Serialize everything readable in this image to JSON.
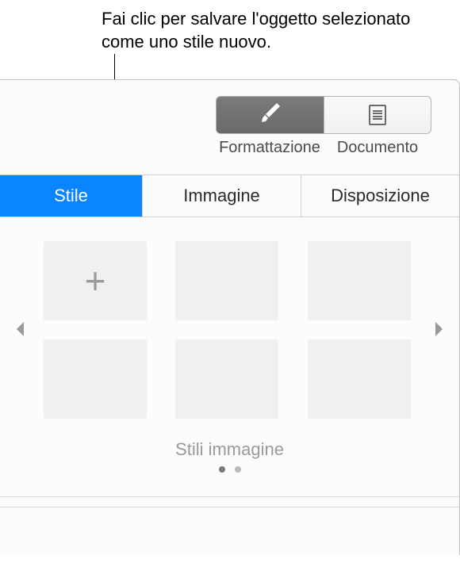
{
  "callout": {
    "text": "Fai clic per salvare l'oggetto selezionato come uno stile nuovo."
  },
  "toolbar": {
    "format": {
      "label": "Formattazione"
    },
    "document": {
      "label": "Documento"
    }
  },
  "tabs": {
    "style": "Stile",
    "image": "Immagine",
    "layout": "Disposizione"
  },
  "styles": {
    "caption": "Stili immagine"
  }
}
